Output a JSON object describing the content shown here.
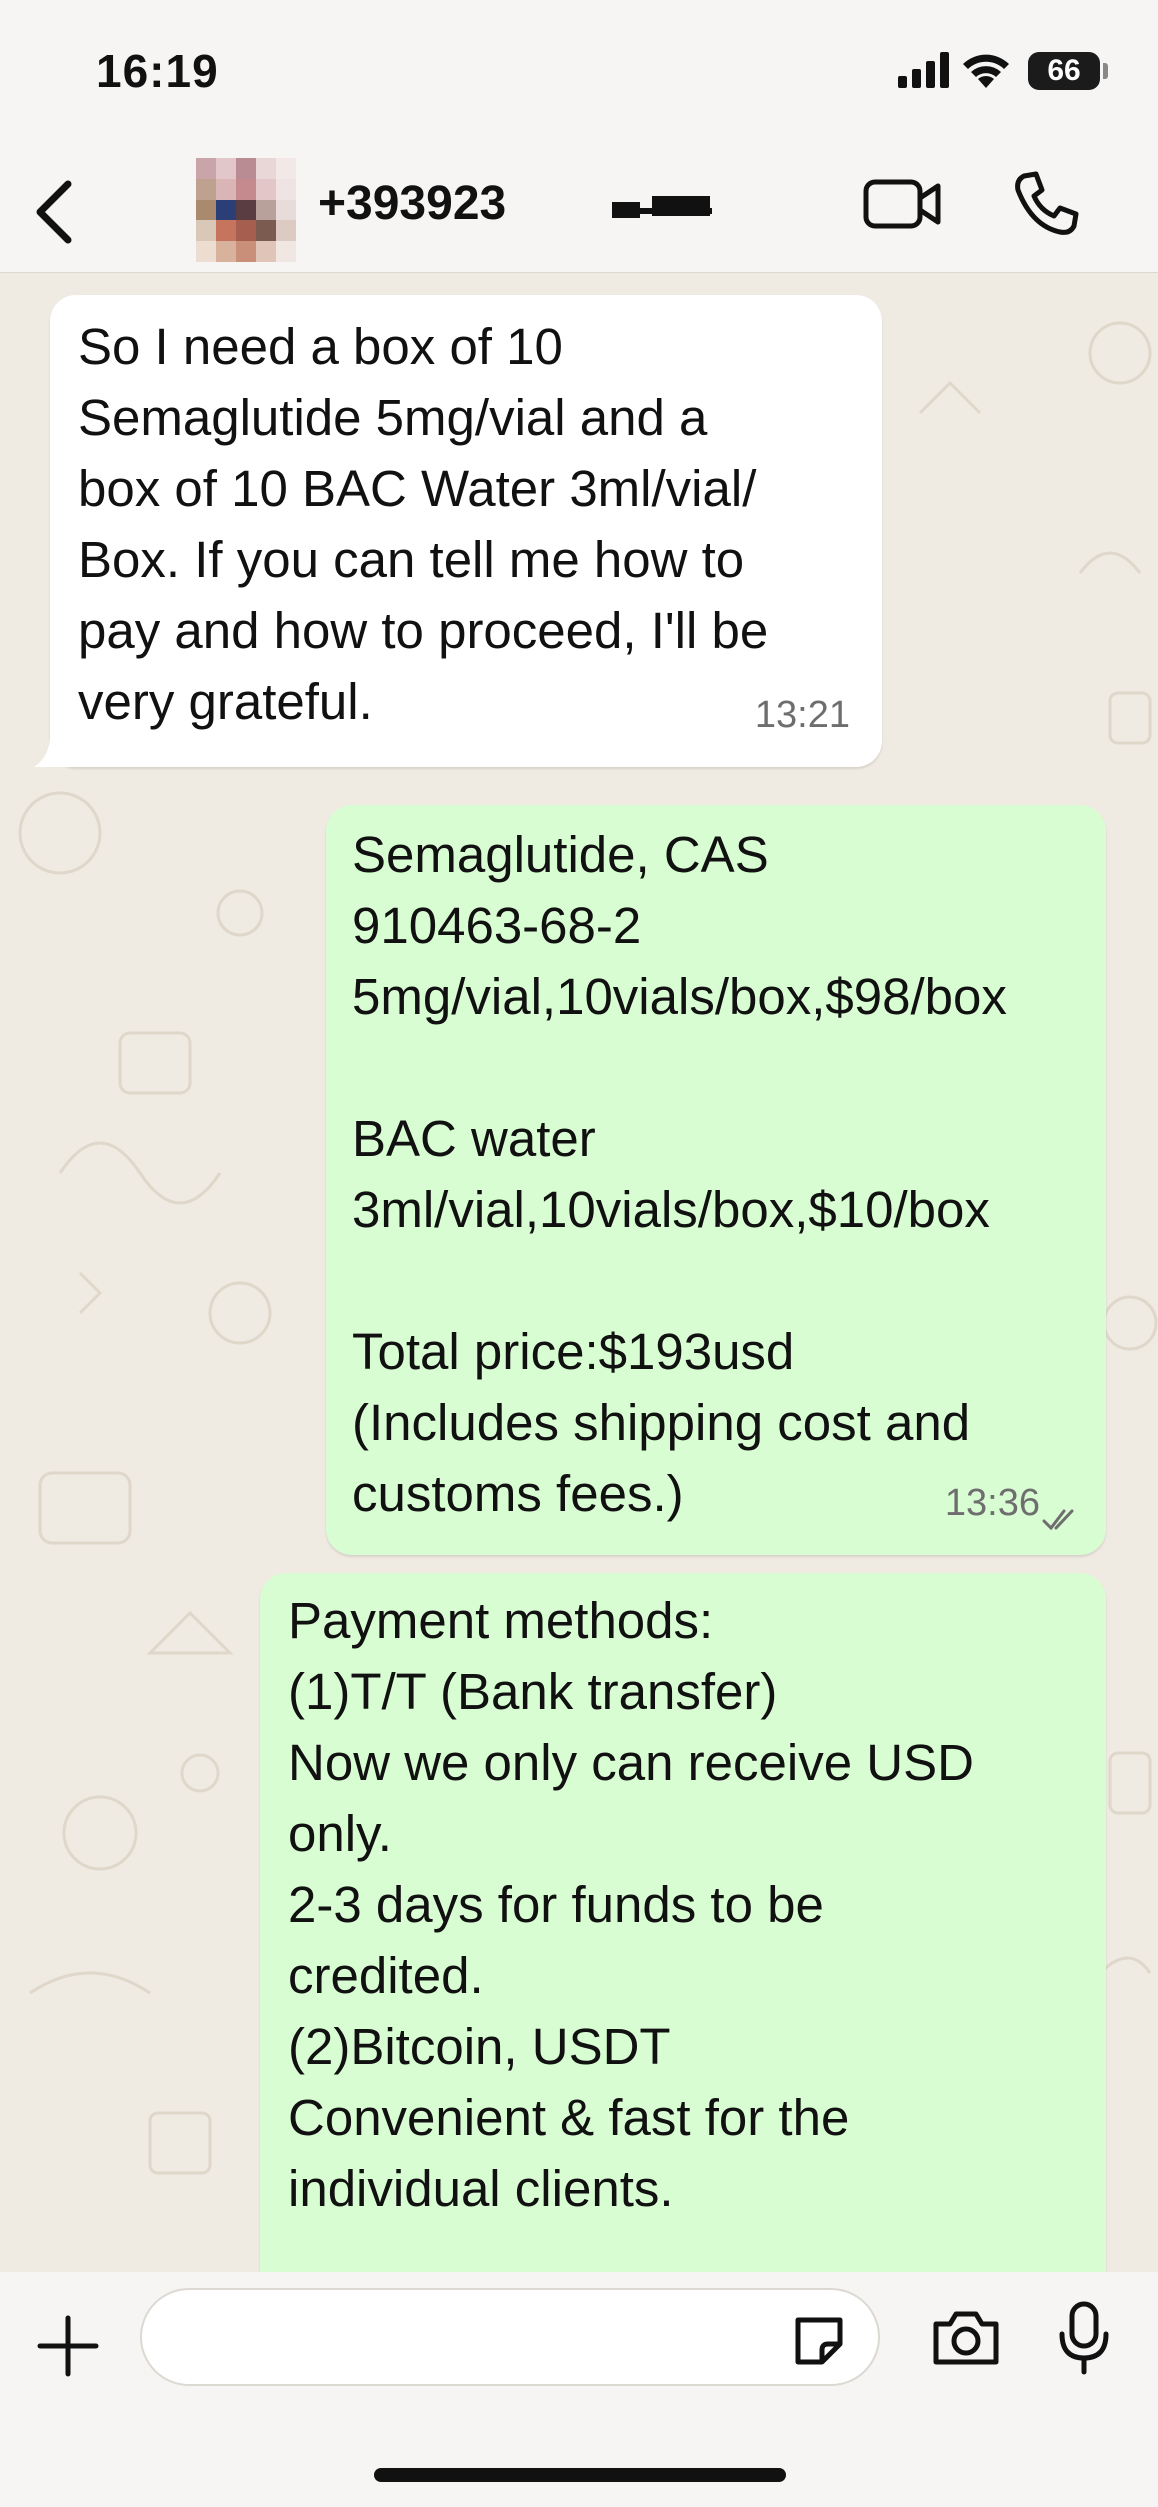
{
  "status_bar": {
    "time": "16:19",
    "battery": "66"
  },
  "header": {
    "contact_name": "+393923",
    "icons": [
      "back-chevron-icon",
      "video-call-icon",
      "voice-call-icon"
    ]
  },
  "messages": [
    {
      "direction": "incoming",
      "text": "So I need a box of 10\nSemaglutide 5mg/vial and a\nbox of 10 BAC Water 3ml/vial/\nBox. If you can tell me how to\npay and how to proceed, I'll be\nvery grateful.",
      "time": "13:21"
    },
    {
      "direction": "outgoing",
      "text": "Semaglutide, CAS\n910463-68-2\n5mg/vial,10vials/box,$98/box\n\nBAC water\n3ml/vial,10vials/box,$10/box\n\nTotal price:$193usd\n(Includes shipping cost and\ncustoms fees.)",
      "time": "13:36",
      "read": true
    },
    {
      "direction": "outgoing",
      "text": "Payment methods:\n(1)T/T (Bank transfer)\nNow we only can receive USD\nonly.\n2-3 days for funds to be\ncredited.\n(2)Bitcoin, USDT\nConvenient & fast for the\nindividual clients.",
      "time": ""
    }
  ],
  "composer": {
    "value": "",
    "placeholder": "",
    "icons": [
      "plus-icon",
      "sticker-icon",
      "camera-icon",
      "microphone-icon"
    ]
  },
  "colors": {
    "wallpaper": "#efeae2",
    "incoming_bubble": "#ffffff",
    "outgoing_bubble": "#d9fdd3",
    "bar_background": "#f6f5f3"
  }
}
